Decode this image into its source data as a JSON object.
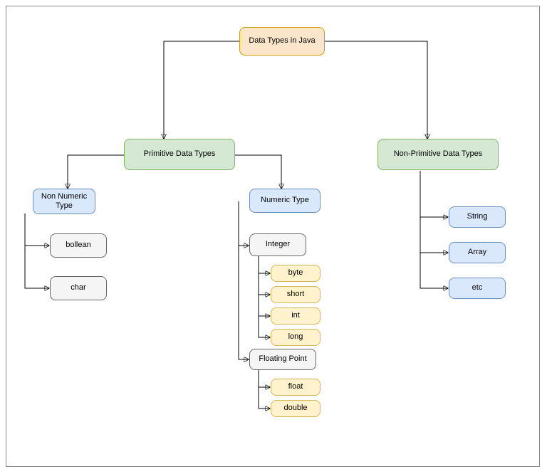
{
  "title": "Data Types in Java",
  "primitive": {
    "label": "Primitive Data Types",
    "nonNumeric": {
      "label": "Non Numeric Type",
      "children": [
        "bollean",
        "char"
      ]
    },
    "numeric": {
      "label": "Numeric Type",
      "integer": {
        "label": "Integer",
        "children": [
          "byte",
          "short",
          "int",
          "long"
        ]
      },
      "floating": {
        "label": "Floating Point",
        "children": [
          "float",
          "double"
        ]
      }
    }
  },
  "nonPrimitive": {
    "label": "Non-Primitive Data Types",
    "children": [
      "String",
      "Array",
      "etc"
    ]
  }
}
